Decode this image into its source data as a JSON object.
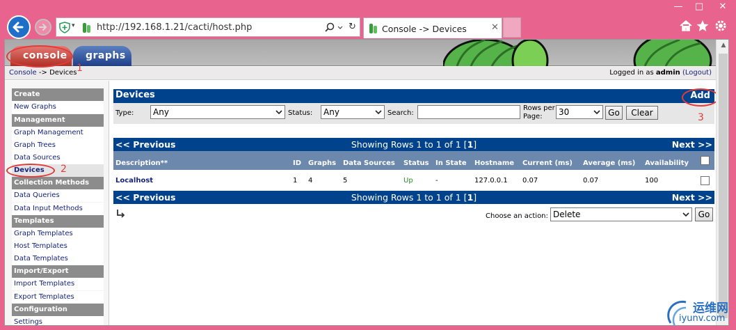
{
  "browser": {
    "url": "http://192.168.1.21/cacti/host.php",
    "tab_title": "Console -> Devices",
    "window_controls": [
      "—",
      "□",
      "✕"
    ],
    "brand_color": "#e8648e"
  },
  "cacti": {
    "tabs": [
      {
        "label": "console",
        "active": true
      },
      {
        "label": "graphs",
        "active": false
      }
    ],
    "breadcrumb": {
      "root": "Console",
      "sep": " -> ",
      "current": "Devices"
    },
    "login": {
      "prefix": "Logged in as ",
      "user": "admin",
      "logout": "(Logout)"
    }
  },
  "sidebar": {
    "items": [
      {
        "label": "Create",
        "kind": "header"
      },
      {
        "label": "New Graphs",
        "kind": "link"
      },
      {
        "label": "Management",
        "kind": "header"
      },
      {
        "label": "Graph Management",
        "kind": "link"
      },
      {
        "label": "Graph Trees",
        "kind": "link"
      },
      {
        "label": "Data Sources",
        "kind": "link"
      },
      {
        "label": "Devices",
        "kind": "link",
        "active": true
      },
      {
        "label": "Collection Methods",
        "kind": "header"
      },
      {
        "label": "Data Queries",
        "kind": "link"
      },
      {
        "label": "Data Input Methods",
        "kind": "link"
      },
      {
        "label": "Templates",
        "kind": "header"
      },
      {
        "label": "Graph Templates",
        "kind": "link"
      },
      {
        "label": "Host Templates",
        "kind": "link"
      },
      {
        "label": "Data Templates",
        "kind": "link"
      },
      {
        "label": "Import/Export",
        "kind": "header"
      },
      {
        "label": "Import Templates",
        "kind": "link"
      },
      {
        "label": "Export Templates",
        "kind": "link"
      },
      {
        "label": "Configuration",
        "kind": "header"
      },
      {
        "label": "Settings",
        "kind": "link"
      }
    ]
  },
  "devices": {
    "title": "Devices",
    "add_label": "Add",
    "filter": {
      "type_label": "Type:",
      "type_value": "Any",
      "status_label": "Status:",
      "status_value": "Any",
      "search_label": "Search:",
      "search_value": "",
      "rows_label_1": "Rows per",
      "rows_label_2": "Page:",
      "rows_value": "30",
      "go_label": "Go",
      "clear_label": "Clear"
    },
    "pager": {
      "prev": "<< Previous",
      "next": "Next >>",
      "showing": "Showing Rows 1 to 1 of 1 [",
      "page": "1",
      "showing_end": "]"
    },
    "columns": [
      "Description**",
      "ID",
      "Graphs",
      "Data Sources",
      "Status",
      "In State",
      "Hostname",
      "Current (ms)",
      "Average (ms)",
      "Availability"
    ],
    "rows": [
      {
        "description": "Localhost",
        "id": "1",
        "graphs": "4",
        "data_sources": "5",
        "status": "Up",
        "in_state": "-",
        "hostname": "127.0.0.1",
        "current": "0.07",
        "average": "0.07",
        "availability": "100"
      }
    ],
    "action": {
      "label": "Choose an action:",
      "value": "Delete",
      "go_label": "Go"
    }
  },
  "annotations": [
    "1",
    "2",
    "3"
  ],
  "watermark": {
    "cn": "运维网",
    "en": "iyunv.com"
  },
  "colors": {
    "panel_blue": "#00438c",
    "table_head": "#6d88ad",
    "status_up": "#2c8a2c",
    "annot_red": "#e23b3b"
  }
}
